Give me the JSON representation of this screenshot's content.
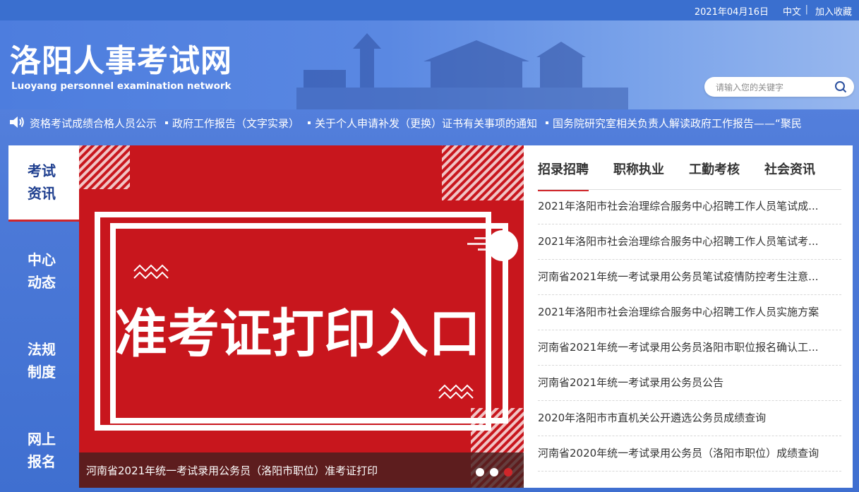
{
  "topbar": {
    "date": "2021年04月16日",
    "lang": "中文",
    "separator": "|",
    "favorite": "加入收藏"
  },
  "header": {
    "title": "洛阳人事考试网",
    "subtitle": "Luoyang personnel examination network"
  },
  "search": {
    "placeholder": "请输入您的关键字",
    "icon": "search-icon"
  },
  "ticker": {
    "icon": "speaker-icon",
    "items": [
      "资格考试成绩合格人员公示",
      "政府工作报告（文字实录）",
      "关于个人申请补发（更换）证书有关事项的通知",
      "国务院研究室相关负责人解读政府工作报告——“聚民"
    ]
  },
  "leftnav": {
    "items": [
      {
        "line1": "考试",
        "line2": "资讯"
      },
      {
        "line1": "中心",
        "line2": "动态"
      },
      {
        "line1": "法规",
        "line2": "制度"
      },
      {
        "line1": "网上",
        "line2": "报名"
      }
    ]
  },
  "slider": {
    "headline": "准考证打印入口",
    "caption": "河南省2021年统一考试录用公务员（洛阳市职位）准考证打印",
    "active_dot": 3,
    "colors": {
      "red": "#c8161d",
      "accent": "#d0262a"
    }
  },
  "newsbox": {
    "tabs": [
      "招录招聘",
      "职称执业",
      "工勤考核",
      "社会资讯"
    ],
    "items": [
      "2021年洛阳市社会治理综合服务中心招聘工作人员笔试成...",
      "2021年洛阳市社会治理综合服务中心招聘工作人员笔试考...",
      "河南省2021年统一考试录用公务员笔试疫情防控考生注意...",
      "2021年洛阳市社会治理综合服务中心招聘工作人员实施方案",
      "河南省2021年统一考试录用公务员洛阳市职位报名确认工...",
      "河南省2021年统一考试录用公务员公告",
      "2020年洛阳市市直机关公开遴选公务员成绩查询",
      "河南省2020年统一考试录用公务员（洛阳市职位）成绩查询"
    ]
  }
}
